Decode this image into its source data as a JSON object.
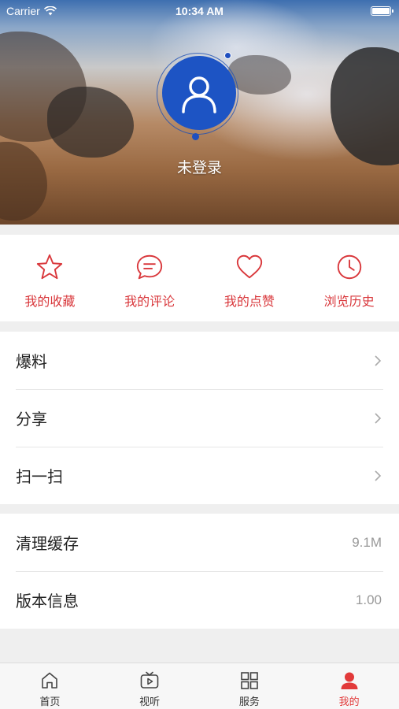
{
  "status_bar": {
    "carrier": "Carrier",
    "time": "10:34 AM"
  },
  "profile": {
    "login_text": "未登录",
    "avatar_icon": "user-icon"
  },
  "quick_actions": [
    {
      "label": "我的收藏",
      "icon": "star-icon"
    },
    {
      "label": "我的评论",
      "icon": "comment-icon"
    },
    {
      "label": "我的点赞",
      "icon": "heart-icon"
    },
    {
      "label": "浏览历史",
      "icon": "clock-icon"
    }
  ],
  "menu_group_1": [
    {
      "label": "爆料"
    },
    {
      "label": "分享"
    },
    {
      "label": "扫一扫"
    }
  ],
  "menu_group_2": [
    {
      "label": "清理缓存",
      "value": "9.1M"
    },
    {
      "label": "版本信息",
      "value": "1.00"
    }
  ],
  "tabs": [
    {
      "label": "首页",
      "icon": "home-icon",
      "active": false
    },
    {
      "label": "视听",
      "icon": "tv-icon",
      "active": false
    },
    {
      "label": "服务",
      "icon": "grid-icon",
      "active": false
    },
    {
      "label": "我的",
      "icon": "person-icon",
      "active": true
    }
  ],
  "colors": {
    "accent": "#d9383c",
    "avatar_bg": "#1d54c4",
    "tab_active": "#e23a3a"
  }
}
